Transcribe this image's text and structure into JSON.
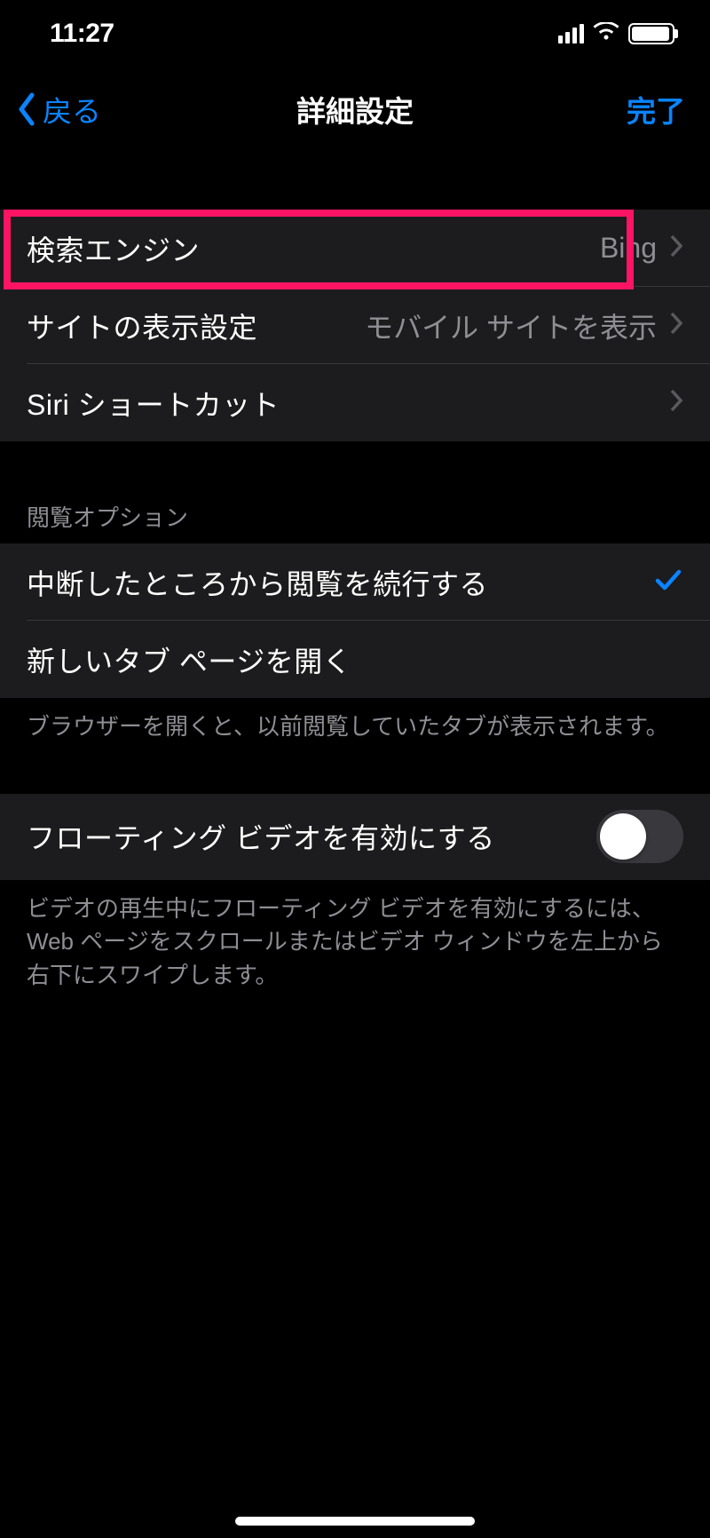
{
  "status": {
    "time": "11:27"
  },
  "nav": {
    "back": "戻る",
    "title": "詳細設定",
    "done": "完了"
  },
  "group1": {
    "rows": [
      {
        "label": "検索エンジン",
        "value": "Bing"
      },
      {
        "label": "サイトの表示設定",
        "value": "モバイル サイトを表示"
      },
      {
        "label": "Siri ショートカット",
        "value": ""
      }
    ]
  },
  "group2": {
    "header": "閲覧オプション",
    "rows": [
      {
        "label": "中断したところから閲覧を続行する",
        "checked": true
      },
      {
        "label": "新しいタブ ページを開く",
        "checked": false
      }
    ],
    "footer": "ブラウザーを開くと、以前閲覧していたタブが表示されます。"
  },
  "group3": {
    "rows": [
      {
        "label": "フローティング ビデオを有効にする",
        "toggle": false
      }
    ],
    "footer": "ビデオの再生中にフローティング ビデオを有効にするには、Web ページをスクロールまたはビデオ ウィンドウを左上から右下にスワイプします。"
  }
}
